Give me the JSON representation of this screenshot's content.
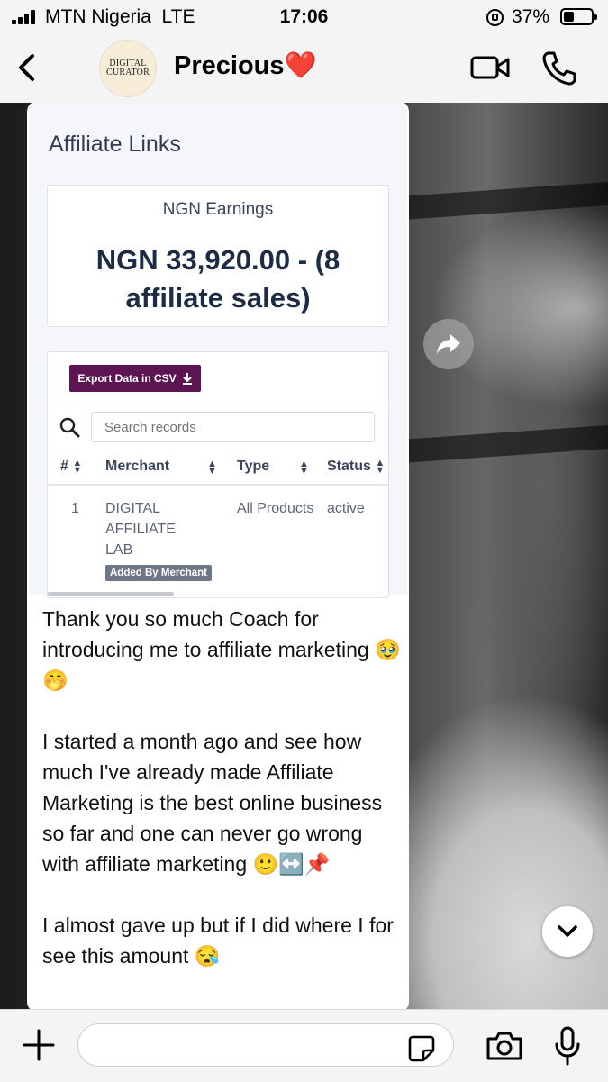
{
  "status_bar": {
    "carrier": "MTN Nigeria",
    "network": "LTE",
    "time": "17:06",
    "battery_percent": "37%",
    "battery_level": 0.37
  },
  "chat_header": {
    "contact_name": "Precious❤️",
    "avatar_text_line1": "DIGITAL",
    "avatar_text_line2": "CURATOR"
  },
  "screenshot": {
    "section_title": "Affiliate Links",
    "earnings_label": "NGN Earnings",
    "earnings_value": "NGN 33,920.00 - (8 affiliate sales)",
    "export_button": "Export Data in CSV",
    "search_placeholder": "Search records",
    "columns": [
      "#",
      "Merchant",
      "Type",
      "Status"
    ],
    "rows": [
      {
        "num": "1",
        "merchant": "DIGITAL AFFILIATE LAB",
        "type": "All Products",
        "status": "active",
        "badge": "Added By Merchant"
      }
    ]
  },
  "message": {
    "text": "Thank you so much Coach for introducing me to affiliate marketing 🥹🤭\n\nI started a month ago and see how much I've already made Affiliate Marketing is the best online business so far and one can never go wrong with affiliate marketing 🙂↔️📌\n\nI almost gave up but if I did where I for see this amount 😪"
  },
  "composer": {
    "input_value": ""
  },
  "icons": {
    "back": "chevron-left-icon",
    "video": "video-call-icon",
    "phone": "phone-call-icon",
    "forward": "forward-icon",
    "scroll_down": "chevron-down-icon",
    "attach": "plus-icon",
    "sticker": "sticker-icon",
    "camera": "camera-icon",
    "mic": "microphone-icon"
  }
}
